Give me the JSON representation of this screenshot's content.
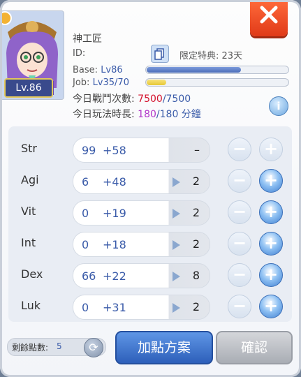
{
  "character": {
    "name": "神工匠",
    "level_badge": "Lv.86",
    "id_label": "ID:",
    "privilege_label": "限定特典",
    "privilege_value": "23天",
    "base_label": "Base:",
    "base_level": "Lv86",
    "base_progress": 0.67,
    "job_label": "Job:",
    "job_level": "Lv35/70",
    "job_progress": 0.14,
    "battle_label": "今日戰鬥次數:",
    "battle_current": "7500",
    "battle_max": "/7500",
    "play_label": "今日玩法時長:",
    "play_current": "180",
    "play_max": "/180 分鐘"
  },
  "stats": [
    {
      "name": "Str",
      "base": "99",
      "bonus": "+58",
      "cost": "–",
      "plus_enabled": false
    },
    {
      "name": "Agi",
      "base": "6",
      "bonus": "+48",
      "cost": "2",
      "plus_enabled": true
    },
    {
      "name": "Vit",
      "base": "0",
      "bonus": "+19",
      "cost": "2",
      "plus_enabled": true
    },
    {
      "name": "Int",
      "base": "0",
      "bonus": "+18",
      "cost": "2",
      "plus_enabled": true
    },
    {
      "name": "Dex",
      "base": "66",
      "bonus": "+22",
      "cost": "8",
      "plus_enabled": true
    },
    {
      "name": "Luk",
      "base": "0",
      "bonus": "+31",
      "cost": "2",
      "plus_enabled": true
    }
  ],
  "footer": {
    "remaining_label": "剩餘點數:",
    "remaining_value": "5",
    "plan_button": "加點方案",
    "confirm_button": "確認"
  },
  "icons": {
    "close": "close-icon",
    "copy": "copy-icon",
    "info": "info-icon",
    "refresh": "refresh-icon",
    "minus": "minus-icon",
    "plus": "plus-icon",
    "arrow": "play-arrow-icon"
  },
  "colors": {
    "accent_blue": "#3a5ba9",
    "battle_red": "#d4122d",
    "play_purple": "#b136c9",
    "close_red": "#e8491f",
    "base_bar": "#5b7fc9",
    "job_bar": "#f0d64e"
  }
}
